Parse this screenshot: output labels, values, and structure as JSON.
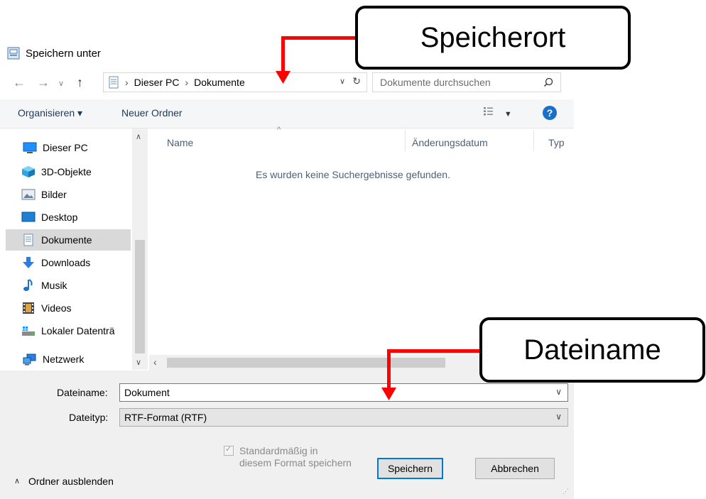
{
  "window": {
    "title": "Speichern unter"
  },
  "nav": {
    "breadcrumb": [
      "Dieser PC",
      "Dokumente"
    ],
    "search_placeholder": "Dokumente durchsuchen"
  },
  "toolbar": {
    "organize_label": "Organisieren ▾",
    "new_folder_label": "Neuer Ordner",
    "help_symbol": "?"
  },
  "sidebar": {
    "items": [
      {
        "label": "Dieser PC",
        "icon": "pc-icon"
      },
      {
        "label": "3D-Objekte",
        "icon": "cube-icon"
      },
      {
        "label": "Bilder",
        "icon": "pictures-icon"
      },
      {
        "label": "Desktop",
        "icon": "desktop-icon"
      },
      {
        "label": "Dokumente",
        "icon": "documents-icon"
      },
      {
        "label": "Downloads",
        "icon": "download-icon"
      },
      {
        "label": "Musik",
        "icon": "music-icon"
      },
      {
        "label": "Videos",
        "icon": "video-icon"
      },
      {
        "label": "Lokaler Datenträ",
        "icon": "drive-icon"
      },
      {
        "label": "Netzwerk",
        "icon": "network-icon"
      }
    ]
  },
  "content": {
    "columns": [
      "Name",
      "Änderungsdatum",
      "Typ"
    ],
    "empty_message": "Es wurden keine Suchergebnisse gefunden."
  },
  "form": {
    "filename_label": "Dateiname:",
    "filename_value": "Dokument",
    "filetype_label": "Dateityp:",
    "filetype_value": "RTF-Format (RTF)",
    "checkbox_line1": "Standardmäßig in",
    "checkbox_line2": "diesem Format speichern",
    "save_label": "Speichern",
    "cancel_label": "Abbrechen",
    "hide_folders_label": "Ordner ausblenden"
  },
  "annotations": {
    "location_label": "Speicherort",
    "filename_label": "Dateiname"
  },
  "colors": {
    "accent": "#0078d7",
    "annotation_arrow": "#ff0000"
  }
}
